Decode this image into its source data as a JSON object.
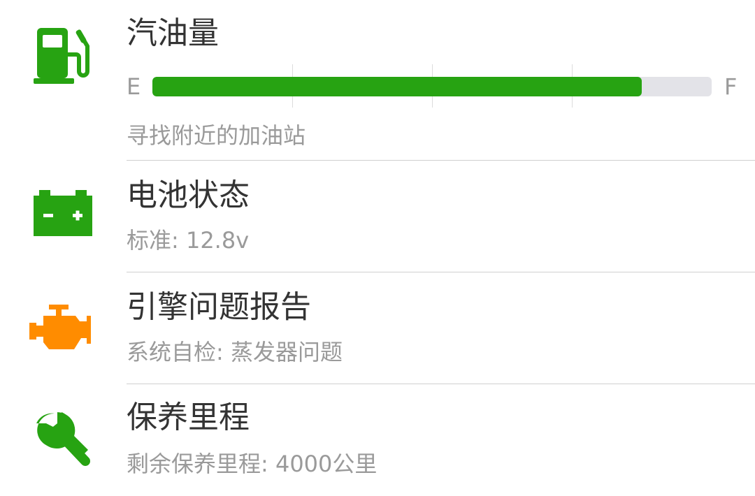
{
  "fuel": {
    "title": "汽油量",
    "empty_label": "E",
    "full_label": "F",
    "level_fraction": 0.875,
    "subtitle": "寻找附近的加油站",
    "icon": "fuel-pump-icon",
    "icon_color": "#27a312"
  },
  "battery": {
    "title": "电池状态",
    "subtitle": "标准: 12.8v",
    "icon": "battery-icon",
    "icon_color": "#27a312"
  },
  "engine": {
    "title": "引擎问题报告",
    "subtitle": "系统自检: 蒸发器问题",
    "icon": "engine-icon",
    "icon_color": "#ff8c00"
  },
  "maintenance": {
    "title": "保养里程",
    "subtitle": "剩余保养里程: 4000公里",
    "icon": "wrench-icon",
    "icon_color": "#27a312"
  }
}
